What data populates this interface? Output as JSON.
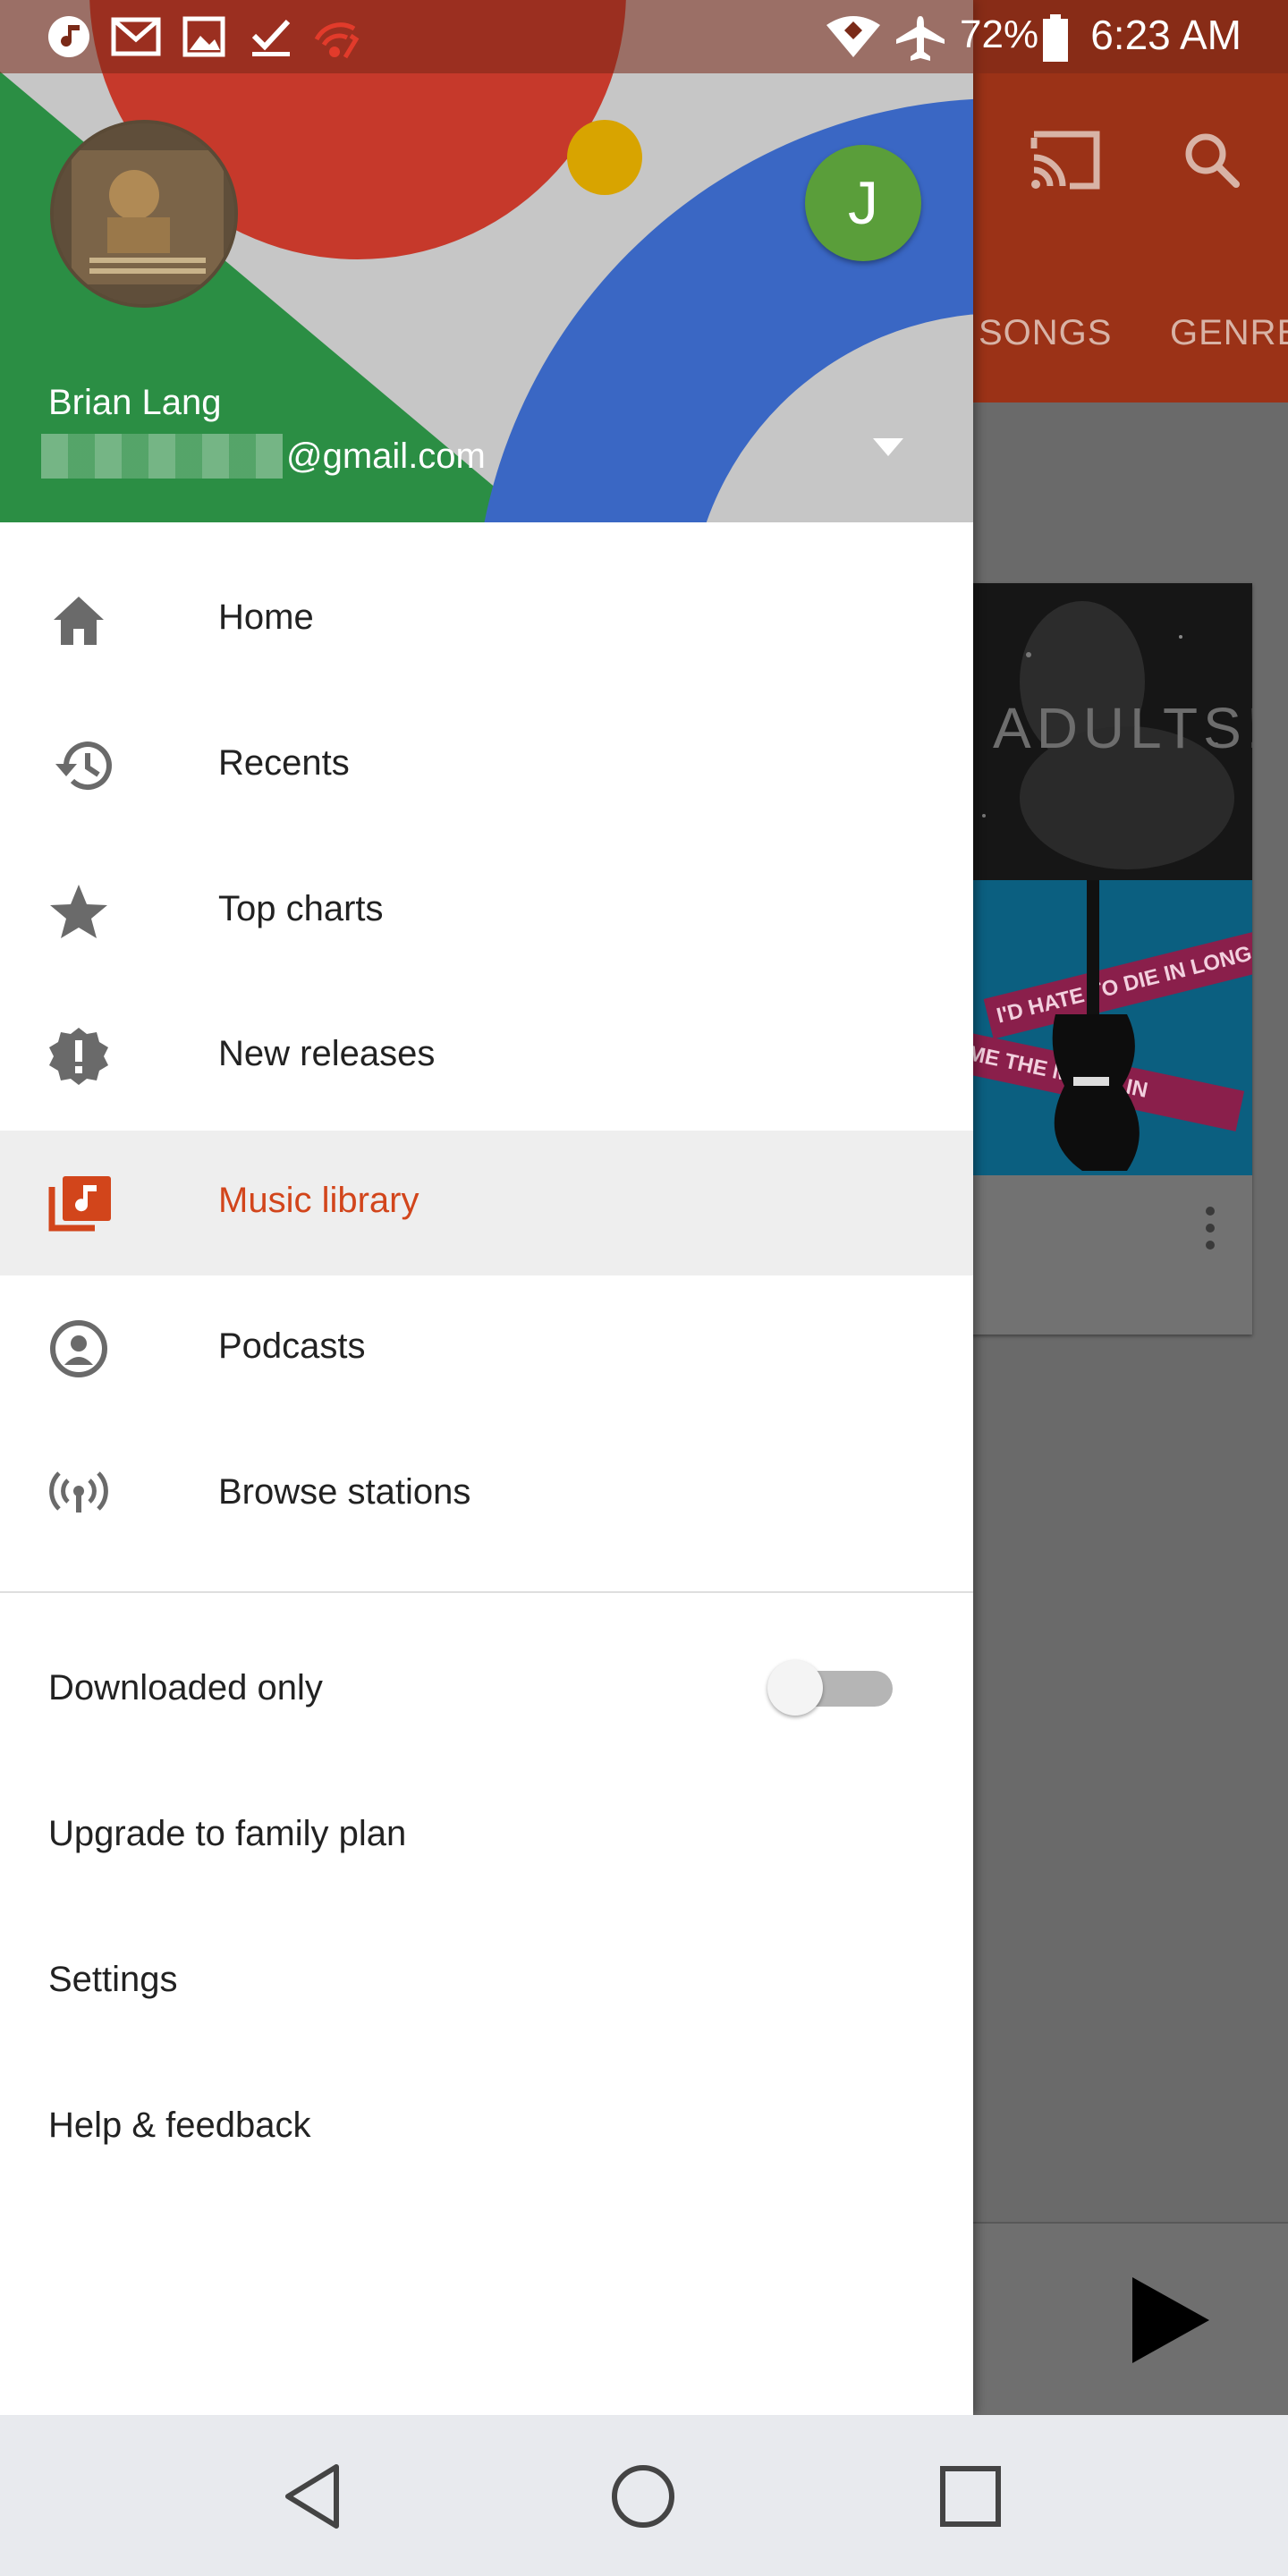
{
  "status_bar": {
    "time": "6:23 AM",
    "battery_percent": "72%",
    "left_icons": [
      "music-note-icon",
      "gmail-icon",
      "image-icon",
      "checkmark-icon",
      "wifi-alert-icon"
    ],
    "right_icons": [
      "wifi-icon",
      "airplane-icon",
      "battery-icon"
    ]
  },
  "background_app": {
    "tabs": [
      "SONGS",
      "GENRES"
    ],
    "toolbar_icons": [
      "cast-icon",
      "search-icon"
    ],
    "album_art_text": "ADULTS!",
    "album_band_1": "I'D HATE TO DIE IN LONG ISLAND",
    "album_band_2": "OME THE MUSIC IN",
    "colors": {
      "toolbar": "#9b3217"
    }
  },
  "account": {
    "name": "Brian Lang",
    "email_suffix": "@gmail.com",
    "secondary_avatar_letter": "J"
  },
  "nav": {
    "items": [
      {
        "label": "Home",
        "icon": "home-icon"
      },
      {
        "label": "Recents",
        "icon": "history-icon"
      },
      {
        "label": "Top charts",
        "icon": "star-icon"
      },
      {
        "label": "New releases",
        "icon": "new-releases-icon"
      },
      {
        "label": "Music library",
        "icon": "music-library-icon",
        "active": true
      },
      {
        "label": "Podcasts",
        "icon": "podcast-icon"
      },
      {
        "label": "Browse stations",
        "icon": "radio-icon"
      }
    ],
    "active_color": "#d2451b"
  },
  "options": {
    "downloaded_only": {
      "label": "Downloaded only",
      "enabled": false
    },
    "upgrade": "Upgrade to family plan",
    "settings": "Settings",
    "help": "Help & feedback"
  },
  "system_nav": [
    "back-icon",
    "home-circle-icon",
    "recents-square-icon"
  ]
}
